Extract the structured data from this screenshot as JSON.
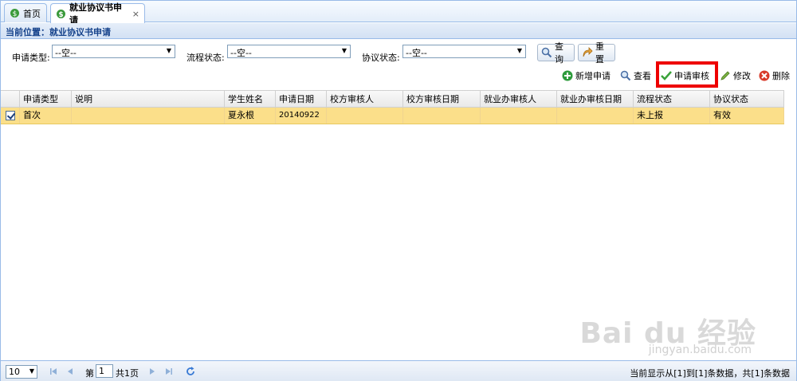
{
  "tabs": [
    {
      "label": "首页"
    },
    {
      "label": "就业协议书申请",
      "close": "×"
    }
  ],
  "breadcrumb": "当前位置：就业协议书申请",
  "filters": {
    "apply_type_label": "申请类型:",
    "apply_type_value": "--空--",
    "flow_status_label": "流程状态:",
    "flow_status_value": "--空--",
    "agreement_status_label": "协议状态:",
    "agreement_status_value": "--空--",
    "query_label": "查询",
    "reset_label": "重置"
  },
  "toolbar": {
    "add_label": "新增申请",
    "view_label": "查看",
    "submit_review_label": "申请审核",
    "edit_label": "修改",
    "delete_label": "删除"
  },
  "grid": {
    "columns": [
      "申请类型",
      "说明",
      "学生姓名",
      "申请日期",
      "校方审核人",
      "校方审核日期",
      "就业办审核人",
      "就业办审核日期",
      "流程状态",
      "协议状态"
    ],
    "rows": [
      {
        "checked": true,
        "cells": [
          "首次",
          "",
          "夏永根",
          "20140922",
          "",
          "",
          "",
          "",
          "未上报",
          "有效"
        ]
      }
    ]
  },
  "pager": {
    "page_size": "10",
    "page_prefix": "第",
    "page_value": "1",
    "page_suffix": "共1页",
    "info": "当前显示从[1]到[1]条数据，共[1]条数据"
  },
  "watermark": {
    "main": "Bai du 经验",
    "sub": "jingyan.baidu.com"
  },
  "colors": {
    "accent": "#99bbe8",
    "selected_row": "#fbdf8a",
    "highlight": "#ee0000"
  }
}
